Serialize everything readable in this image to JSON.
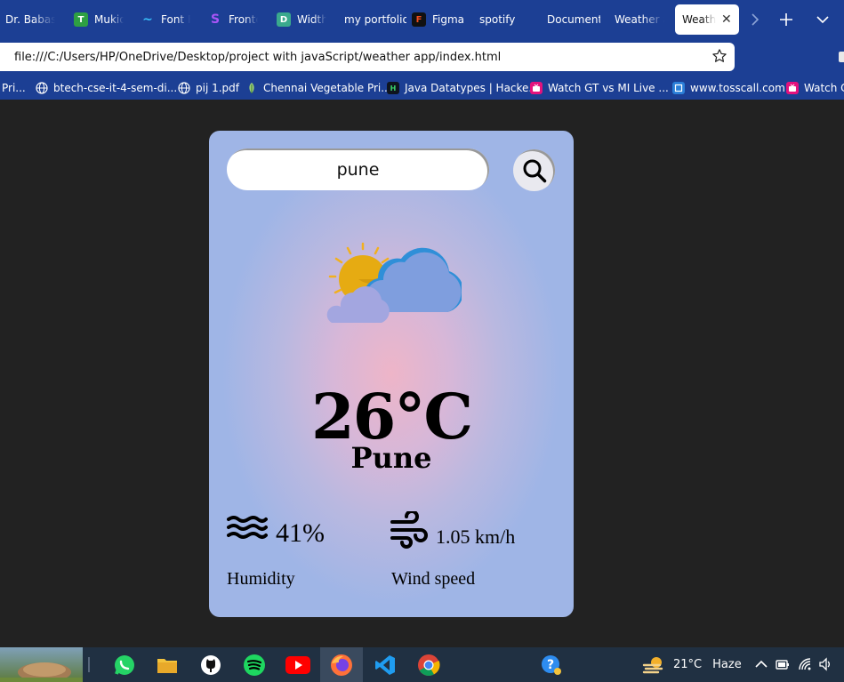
{
  "browser": {
    "tabs": [
      {
        "label": "Dr. Babasaheb",
        "icon": "",
        "icon_color": ""
      },
      {
        "label": "Mukiders",
        "icon": "T",
        "icon_color": "#2ea043"
      },
      {
        "label": "Font Flipper",
        "icon": "~",
        "icon_color": "#38bdf8"
      },
      {
        "label": "Frontend",
        "icon": "S",
        "icon_color": "#a855f7"
      },
      {
        "label": "Width",
        "icon": "D",
        "icon_color": "#3aa98d"
      },
      {
        "label": "my portfolio",
        "icon": "",
        "icon_color": ""
      },
      {
        "label": "Figma",
        "icon": "F",
        "icon_color": "#111111"
      },
      {
        "label": "spotify",
        "icon": "",
        "icon_color": ""
      },
      {
        "label": "Document",
        "icon": "",
        "icon_color": ""
      },
      {
        "label": "Weather app",
        "icon": "",
        "icon_color": ""
      },
      {
        "label": "Weather app",
        "icon": "",
        "icon_color": ""
      }
    ],
    "address": "file:///C:/Users/HP/OneDrive/Desktop/project with javaScript/weather app/index.html",
    "bookmarks": [
      {
        "label": "Pri...",
        "icon": ""
      },
      {
        "label": "btech-cse-it-4-sem-di...",
        "icon": "globe"
      },
      {
        "label": "pij 1.pdf",
        "icon": "globe"
      },
      {
        "label": "Chennai Vegetable Pri...",
        "icon": "leaf"
      },
      {
        "label": "Java Datatypes | Hacke...",
        "icon": "H"
      },
      {
        "label": "Watch GT vs MI Live ...",
        "icon": "tv"
      },
      {
        "label": "www.tosscall.com",
        "icon": "box"
      },
      {
        "label": "Watch C",
        "icon": "tv"
      }
    ]
  },
  "weather": {
    "search_value": "pune",
    "temperature": "26°C",
    "city": "Pune",
    "humidity": "41%",
    "humidity_label": "Humidity",
    "wind": "1.05 km/h",
    "wind_label": "Wind speed"
  },
  "taskbar": {
    "weather_temp": "21°C",
    "weather_desc": "Haze",
    "apps": [
      "whatsapp",
      "file-explorer",
      "github",
      "spotify",
      "youtube",
      "firefox",
      "vs-code",
      "chrome",
      "help"
    ]
  },
  "colors": {
    "chrome_blue": "#1c3f94",
    "page_bg": "#222222",
    "card_pink": "#eeb5c8",
    "card_blue": "#9fb5e6"
  }
}
